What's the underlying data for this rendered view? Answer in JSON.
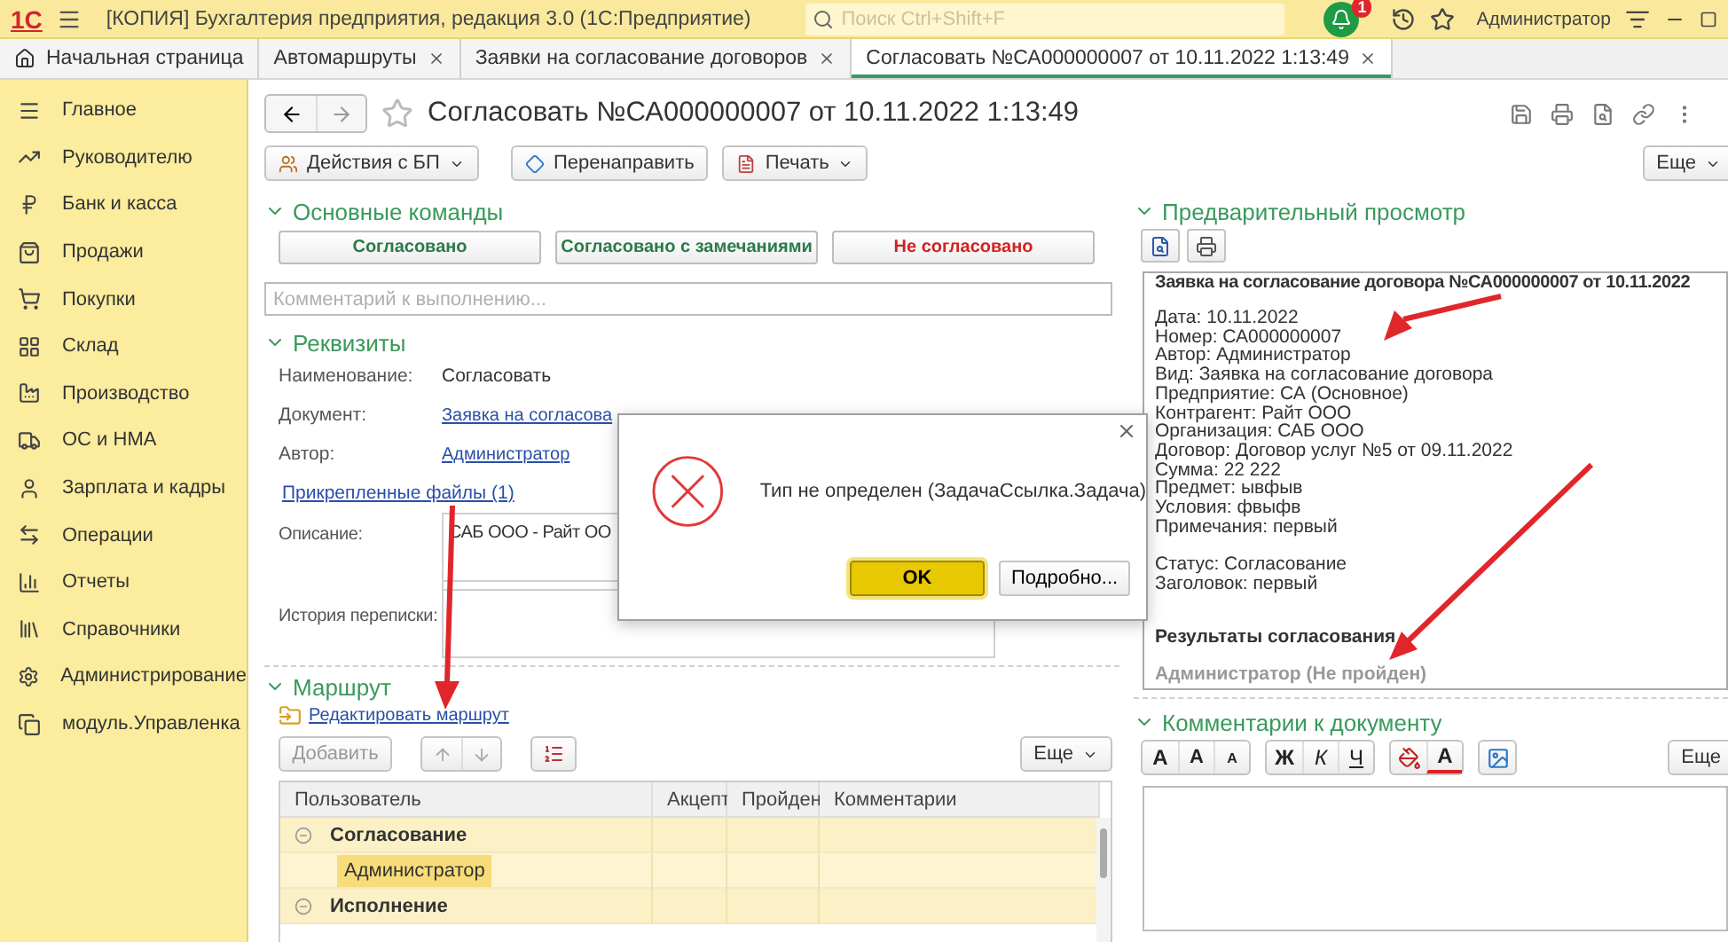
{
  "title_bar": {
    "logo": "1С",
    "title": "[КОПИЯ] Бухгалтерия предприятия, редакция 3.0  (1С:Предприятие)",
    "search": {
      "placeholder": "Поиск Ctrl+Shift+F"
    },
    "notifications": "1",
    "user": "Администратор"
  },
  "tabs": [
    {
      "label": "Начальная страница",
      "kind": "home",
      "selected": false
    },
    {
      "label": "Автомаршруты",
      "kind": "closable",
      "selected": false
    },
    {
      "label": "Заявки на согласование договоров",
      "kind": "closable",
      "selected": false
    },
    {
      "label": "Согласовать №СА000000007 от 10.11.2022 1:13:49",
      "kind": "closable",
      "selected": true
    }
  ],
  "sidebar": {
    "items": [
      {
        "label": "Главное"
      },
      {
        "label": "Руководителю"
      },
      {
        "label": "Банк и касса"
      },
      {
        "label": "Продажи"
      },
      {
        "label": "Покупки"
      },
      {
        "label": "Склад"
      },
      {
        "label": "Производство"
      },
      {
        "label": "ОС и НМА"
      },
      {
        "label": "Зарплата и кадры"
      },
      {
        "label": "Операции"
      },
      {
        "label": "Отчеты"
      },
      {
        "label": "Справочники"
      },
      {
        "label": "Администрирование"
      },
      {
        "label": "модуль.Управленка"
      }
    ]
  },
  "form": {
    "title": "Согласовать №СА000000007 от 10.11.2022 1:13:49",
    "toolbar": [
      {
        "label": "Действия с БП",
        "kind": "actions",
        "dropdown": true
      },
      {
        "label": "Перенаправить",
        "kind": "forward",
        "dropdown": false
      },
      {
        "label": "Печать",
        "kind": "print",
        "dropdown": true
      }
    ],
    "more_button": "Еще"
  },
  "main_commands": {
    "title": "Основные команды",
    "buttons": [
      {
        "label": "Согласовано",
        "kind": "approve"
      },
      {
        "label": "Согласовано с замечаниями",
        "kind": "approve"
      },
      {
        "label": "Не согласовано",
        "kind": "reject"
      }
    ],
    "comment": {
      "placeholder": "Комментарий к выполнению..."
    }
  },
  "details": {
    "title": "Реквизиты",
    "fields": [
      {
        "label": "Наименование:",
        "value": "Согласовать",
        "kind": "text"
      },
      {
        "label": "Документ:",
        "value": "Заявка на согласова",
        "kind": "link"
      },
      {
        "label": "Автор:",
        "value": "Администратор",
        "kind": "link"
      }
    ],
    "attachments": "Прикрепленные файлы (1)",
    "description": {
      "label": "Описание:",
      "value": "САБ ООО - Райт ОО"
    },
    "history": {
      "label": "История переписки:"
    }
  },
  "route": {
    "title": "Маршрут",
    "edit_link": "Редактировать маршрут",
    "add_button": "Добавить",
    "more_button": "Еще",
    "table": {
      "columns": [
        "Пользователь",
        "Акцепт",
        "Пройден",
        "Комментарии"
      ],
      "rows": [
        {
          "kind": "group",
          "label": "Согласование",
          "expanded": true,
          "selected": false
        },
        {
          "kind": "user",
          "label": "Администратор",
          "selected": true
        },
        {
          "kind": "group",
          "label": "Исполнение",
          "expanded": true,
          "selected": false
        }
      ]
    }
  },
  "preview": {
    "title": "Предварительный просмотр",
    "heading": "Заявка на согласование договора №СА000000007 от 10.11.2022",
    "blocks": [
      [
        "Дата: 10.11.2022",
        "Номер: СА000000007",
        "Автор: Администратор",
        "Вид: Заявка на согласование договора",
        "Предприятие: СА (Основное)",
        "Контрагент: Райт ООО",
        "Организация: САБ ООО",
        "Договор: Договор услуг №5 от 09.11.2022",
        "Сумма: 22 222",
        "Предмет: ывфыв",
        "Условия: фвыфв",
        "Примечания: первый"
      ],
      [
        "Статус: Согласование",
        "Заголовок: первый"
      ]
    ],
    "results_title": "Результаты согласования",
    "results": [
      "Администратор (Не пройден)"
    ]
  },
  "comments": {
    "title": "Комментарии к документу",
    "more_button": "Еще",
    "format_groups": [
      [
        {
          "kind": "font",
          "label": "A"
        },
        {
          "kind": "grow",
          "label": "A"
        },
        {
          "kind": "shrink",
          "label": "A"
        }
      ],
      [
        {
          "kind": "bold",
          "label": "Ж"
        },
        {
          "kind": "italic",
          "label": "К"
        },
        {
          "kind": "underline",
          "label": "Ч"
        }
      ],
      [
        {
          "kind": "fill"
        },
        {
          "kind": "color",
          "label": "A"
        }
      ],
      [
        {
          "kind": "image"
        }
      ]
    ]
  },
  "dialog": {
    "message": "Тип не определен (ЗадачаСсылка.Задача)",
    "buttons": [
      {
        "label": "OK",
        "kind": "default"
      },
      {
        "label": "Подробно...",
        "kind": "normal"
      }
    ]
  }
}
